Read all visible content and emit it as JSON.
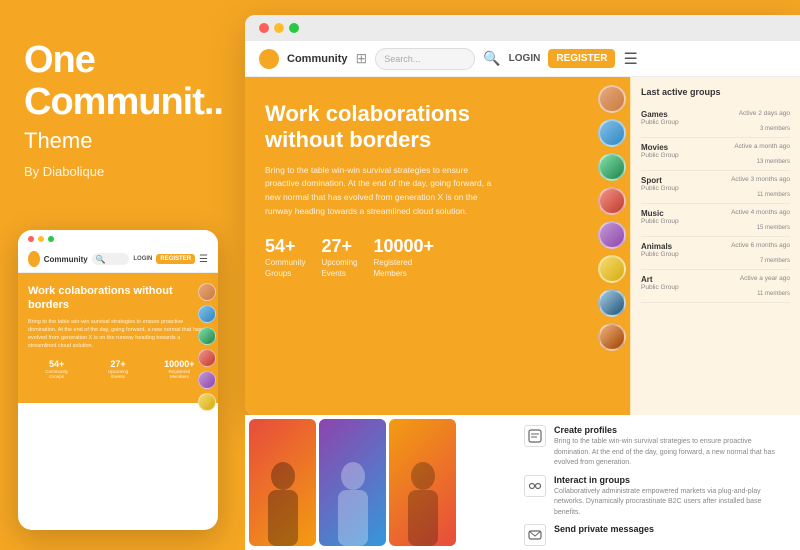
{
  "brand": {
    "title_line1": "One",
    "title_line2": "Communit..",
    "subtitle": "Theme",
    "by": "By Diabolique"
  },
  "browser": {
    "nav": {
      "logo_text": "Community",
      "search_placeholder": "Search...",
      "login_label": "LOGIN",
      "register_label": "REGISTER"
    },
    "hero": {
      "title_bold": "Work",
      "title_rest": " colaborations",
      "title_line2": "without borders",
      "description": "Bring to the table win-win survival strategies to ensure proactive domination. At the end of the day, going forward, a new normal that has evolved from generation X is on the runway heading towards a streamlined cloud solution.",
      "stats": [
        {
          "number": "54+",
          "label": "Community\nGroups"
        },
        {
          "number": "27+",
          "label": "Upcoming\nEvents"
        },
        {
          "number": "10000+",
          "label": "Registered\nMembers"
        }
      ]
    },
    "sidebar": {
      "title": "Last active groups",
      "groups": [
        {
          "name": "Games",
          "type": "Public Group",
          "active": "Active 2 days ago",
          "members": "3 members"
        },
        {
          "name": "Movies",
          "type": "Public Group",
          "active": "Active a month ago",
          "members": "13 members"
        },
        {
          "name": "Sport",
          "type": "Public Group",
          "active": "Active 3 months ago",
          "members": "11 members"
        },
        {
          "name": "Music",
          "type": "Public Group",
          "active": "Active 4 months ago",
          "members": "15 members"
        },
        {
          "name": "Animals",
          "type": "Public Group",
          "active": "Active 6 months ago",
          "members": "7 members"
        },
        {
          "name": "Art",
          "type": "Public Group",
          "active": "Active a year ago",
          "members": "11 members"
        }
      ]
    },
    "features": [
      {
        "icon": "👤",
        "title": "Create profiles",
        "desc": "Bring to the table win-win survival strategies to ensure proactive domination. At the end of the day, going forward, a new normal that has evolved from generation."
      },
      {
        "icon": "↔",
        "title": "Interact in groups",
        "desc": "Collaboratively administrate empowered markets via plug-and-play networks. Dynamically procrastinate B2C users after installed base benefits."
      },
      {
        "icon": "✉",
        "title": "Send private messages",
        "desc": ""
      }
    ]
  },
  "mobile": {
    "hero": {
      "title": "Work colaborations without borders",
      "description": "Bring to the table win-win survival strategies to ensure proactive domination. At the end of the day, going forward, a new normal that has evolved from generation X is on the runway heading towards a streamlined cloud solution.",
      "stats": [
        {
          "number": "54+",
          "label": "Community\nGroups"
        },
        {
          "number": "27+",
          "label": "Upcoming\nEvents"
        },
        {
          "number": "10000+",
          "label": "Registered\nMembers"
        }
      ]
    },
    "nav": {
      "logo_text": "Community",
      "login_label": "LOGIN",
      "register_label": "REGISTER"
    }
  },
  "colors": {
    "orange": "#F5A623",
    "white": "#ffffff",
    "dark": "#222222"
  }
}
